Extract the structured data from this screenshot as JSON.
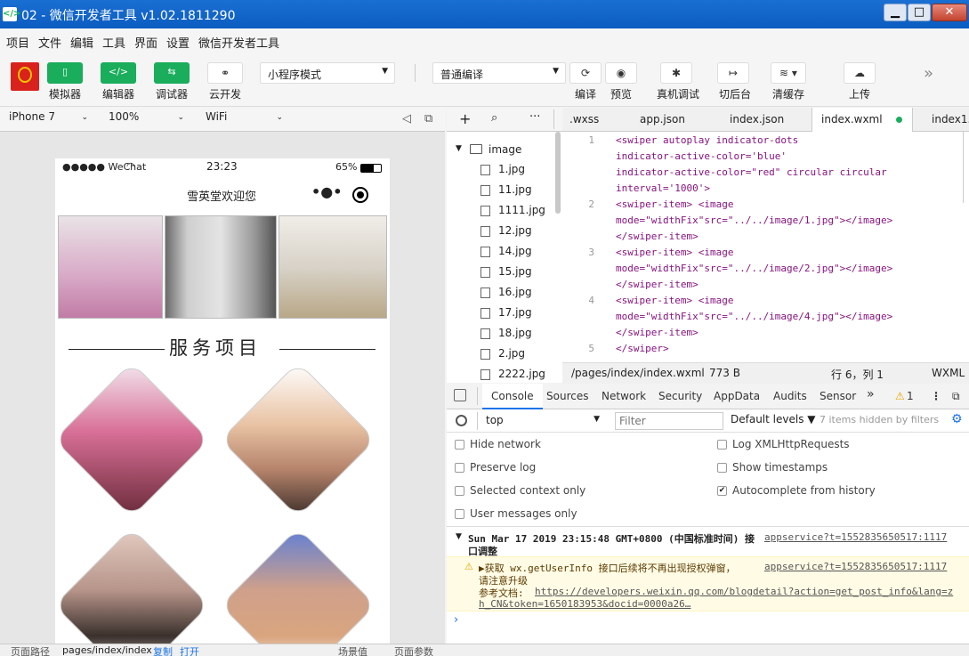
{
  "window": {
    "title": "02 - 微信开发者工具 v1.02.1811290",
    "icon": "</>",
    "minimize": "▁",
    "maximize": "□",
    "close": "✕"
  },
  "menu": [
    "项目",
    "文件",
    "编辑",
    "工具",
    "界面",
    "设置",
    "微信开发者工具"
  ],
  "toolbar": {
    "simulator": "模拟器",
    "editor": "编辑器",
    "debugger": "调试器",
    "cloud": "云开发",
    "mode_select": "小程序模式",
    "compile_select": "普通编译",
    "compile": "编译",
    "preview": "预览",
    "remote_debug": "真机调试",
    "backend": "切后台",
    "clear_cache": "清缓存",
    "upload": "上传",
    "more": "»",
    "colors": {
      "simulator": "#1aad5c",
      "editor": "#1aad5c",
      "debugger": "#1aad5c"
    }
  },
  "device": {
    "model": "iPhone 7",
    "zoom": "100%",
    "network": "WiFi"
  },
  "phone": {
    "carrier": "●●●●● WeChat",
    "time": "23:23",
    "battery": "65%",
    "nav_title": "雪英堂欢迎您",
    "section_title": "服务项目"
  },
  "tree": {
    "folder": "image",
    "files": [
      "1.jpg",
      "11.jpg",
      "1111.jpg",
      "12.jpg",
      "14.jpg",
      "15.jpg",
      "16.jpg",
      "17.jpg",
      "18.jpg",
      "2.jpg",
      "2222.jpg"
    ]
  },
  "tabs": [
    ".wxss",
    "app.json",
    "index.json",
    "index.wxml",
    "index1."
  ],
  "code": {
    "line_numbers": [
      "1",
      "2",
      "3",
      "4",
      "5"
    ],
    "lines": [
      "<swiper autoplay indicator-dots",
      "indicator-active-color='blue'",
      "indicator-active-color=\"red\" circular circular",
      "interval='1000'>",
      "<swiper-item> <image",
      "mode=\"widthFix\"src=\"../../image/1.jpg\"></image>",
      "</swiper-item>",
      "<swiper-item> <image",
      "mode=\"widthFix\"src=\"../../image/2.jpg\"></image>",
      "</swiper-item>",
      "<swiper-item> <image",
      "mode=\"widthFix\"src=\"../../image/4.jpg\"></image>",
      "</swiper-item>",
      "</swiper>"
    ]
  },
  "editor_status": {
    "path": "/pages/index/index.wxml",
    "size": "773 B",
    "position": "行 6，列 1",
    "lang": "WXML"
  },
  "devtools": {
    "tabs": [
      "Console",
      "Sources",
      "Network",
      "Security",
      "AppData",
      "Audits",
      "Sensor"
    ],
    "more": "»",
    "warn_count": "1",
    "context": "top",
    "filter_placeholder": "Filter",
    "levels": "Default levels ▼",
    "hidden": "7 items hidden by filters",
    "settings_left": [
      "Hide network",
      "Preserve log",
      "Selected context only",
      "User messages only"
    ],
    "settings_right": [
      "Log XMLHttpRequests",
      "Show timestamps",
      "Autocomplete from history"
    ],
    "autocomplete_checked": "✔"
  },
  "console": {
    "log1_text": "Sun Mar 17 2019 23:15:48 GMT+0800 (中国标准时间) 接",
    "log1_cont": "口调整",
    "log1_link": "appservice?t=1552835650517:1117",
    "warn_line1": "▶获取 wx.getUserInfo 接口后续将不再出现授权弹窗，",
    "warn_link": "appservice?t=1552835650517:1117",
    "warn_line2": "请注意升级",
    "warn_label": "参考文档:",
    "warn_url1": "https://developers.weixin.qq.com/blogdetail?action=get_post_info&lang=z",
    "warn_url2": "h_CN&token=1650183953&docid=0000a26…",
    "prompt": "›"
  },
  "bottom": {
    "path_label": "页面路径",
    "path": "pages/index/index",
    "copy": "复制",
    "open": "打开",
    "scene": "场景值",
    "params": "页面参数"
  }
}
